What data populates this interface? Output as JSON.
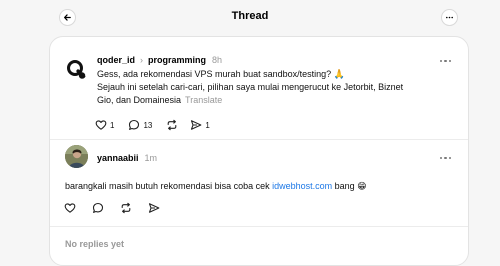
{
  "header": {
    "title": "Thread"
  },
  "thread_post": {
    "username": "qoder_id",
    "topic": "programming",
    "time": "8h",
    "line1": "Gess, ada rekomendasi VPS murah buat sandbox/testing? 🙏",
    "line2": "Sejauh ini setelah cari-cari, pilihan saya mulai mengerucut ke Jetorbit, Biznet",
    "line3": "Gio, dan Domainesia",
    "translate": "Translate",
    "likes": "1",
    "replies": "13",
    "shares": "1"
  },
  "reply_post": {
    "username": "yannaabii",
    "time": "1m",
    "text_before": "barangkali masih butuh rekomendasi bisa coba cek ",
    "link": "idwebhost.com",
    "text_after": " bang 😁"
  },
  "footer": {
    "no_replies": "No replies yet"
  }
}
